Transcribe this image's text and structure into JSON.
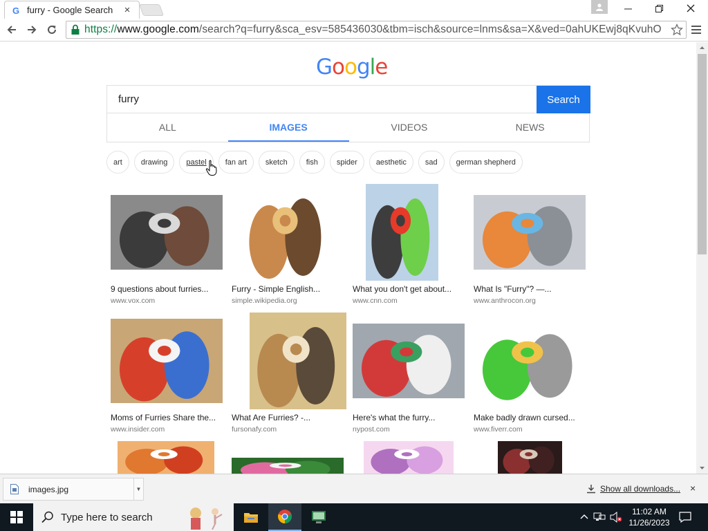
{
  "browser": {
    "tab_title": "furry - Google Search",
    "url_scheme": "https://",
    "url_host": "www.google.com",
    "url_path": "/search?q=furry&sca_esv=585436030&tbm=isch&source=lnms&sa=X&ved=0ahUKEwj8qKvuhO"
  },
  "google": {
    "logo_letters": [
      "G",
      "o",
      "o",
      "g",
      "l",
      "e"
    ],
    "logo_colors": [
      "#4285f4",
      "#ea4335",
      "#fbbc05",
      "#4285f4",
      "#34a853",
      "#ea4335"
    ],
    "query": "furry",
    "search_button": "Search",
    "tabs": [
      "ALL",
      "IMAGES",
      "VIDEOS",
      "NEWS"
    ],
    "active_tab": "IMAGES",
    "chips": [
      "art",
      "drawing",
      "pastel",
      "fan art",
      "sketch",
      "fish",
      "spider",
      "aesthetic",
      "sad",
      "german shepherd"
    ]
  },
  "results": [
    {
      "title": "9 questions about furries...",
      "source": "www.vox.com",
      "colors": [
        "#8a8a8a",
        "#3b3b3b",
        "#d9d9d9",
        "#6e4b3a"
      ]
    },
    {
      "title": "Furry - Simple English...",
      "source": "simple.wikipedia.org",
      "colors": [
        "#ffffff",
        "#c9894c",
        "#e8c07a",
        "#6b4a2e"
      ]
    },
    {
      "title": "What you don't get about...",
      "source": "www.cnn.com",
      "colors": [
        "#bcd2e6",
        "#3d3d3d",
        "#e63a2a",
        "#6ecf4a"
      ]
    },
    {
      "title": "What Is \"Furry\"? —...",
      "source": "www.anthrocon.org",
      "colors": [
        "#c8ccd2",
        "#e9873a",
        "#69b6e4",
        "#8b8f96"
      ]
    },
    {
      "title": "Moms of Furries Share the...",
      "source": "www.insider.com",
      "colors": [
        "#c9a675",
        "#d6402a",
        "#f4f4f4",
        "#3a6fd0"
      ]
    },
    {
      "title": "What Are Furries? -...",
      "source": "fursonafy.com",
      "colors": [
        "#d8c08a",
        "#b88a50",
        "#f1e3c8",
        "#5a4a3a"
      ]
    },
    {
      "title": "Here's what the furry...",
      "source": "nypost.com",
      "colors": [
        "#a0a7ae",
        "#d23a3a",
        "#3aa060",
        "#efefef"
      ]
    },
    {
      "title": "Make badly drawn cursed...",
      "source": "www.fiverr.com",
      "colors": [
        "#ffffff",
        "#46c83a",
        "#f0c24a",
        "#9a9a9a"
      ]
    },
    {
      "title": "",
      "source": "",
      "colors": [
        "#f0b070",
        "#e07830",
        "#ffffff",
        "#d04020"
      ]
    },
    {
      "title": "",
      "source": "",
      "colors": [
        "#2a6a2a",
        "#e06aa0",
        "#f4f4f4",
        "#3a8a3a"
      ]
    },
    {
      "title": "",
      "source": "",
      "colors": [
        "#f5d8f0",
        "#b070c0",
        "#ffffff",
        "#d8a0e0"
      ]
    },
    {
      "title": "",
      "source": "",
      "colors": [
        "#2a1a1a",
        "#8a3030",
        "#d8c8b8",
        "#402020"
      ]
    }
  ],
  "downloads": {
    "file_name": "images.jpg",
    "show_all": "Show all downloads..."
  },
  "taskbar": {
    "search_placeholder": "Type here to search",
    "time": "11:02 AM",
    "date": "11/26/2023"
  }
}
